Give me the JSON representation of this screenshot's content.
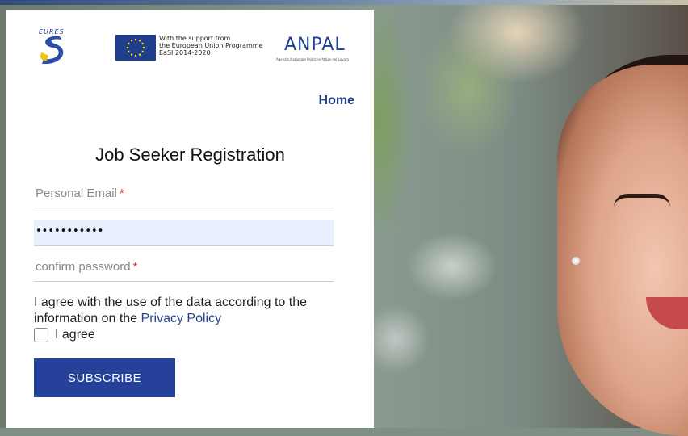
{
  "header": {
    "eures_logo_text": "EURES",
    "eu_support_text": "With the support from\nthe European Union Programme\nEaSI 2014-2020",
    "anpal_logo_text": "ANPAL",
    "anpal_subtitle": "Agenzia Nazionale Politiche Attive del Lavoro"
  },
  "nav": {
    "home_label": "Home"
  },
  "form": {
    "title": "Job Seeker Registration",
    "email_placeholder": "Personal Email",
    "password_value": "•••••••••••",
    "confirm_placeholder": "confirm password",
    "required_marker": "*",
    "consent_text_before": "I agree with the use of the data according to the information on the ",
    "privacy_link_label": "Privacy Policy",
    "agree_label": "I agree",
    "agree_checked": false,
    "subscribe_label": "SUBSCRIBE"
  },
  "colors": {
    "brand_blue": "#25419a",
    "link_blue": "#28408a",
    "required_red": "#d32f2f",
    "autofill_bg": "#e8f0fe"
  }
}
